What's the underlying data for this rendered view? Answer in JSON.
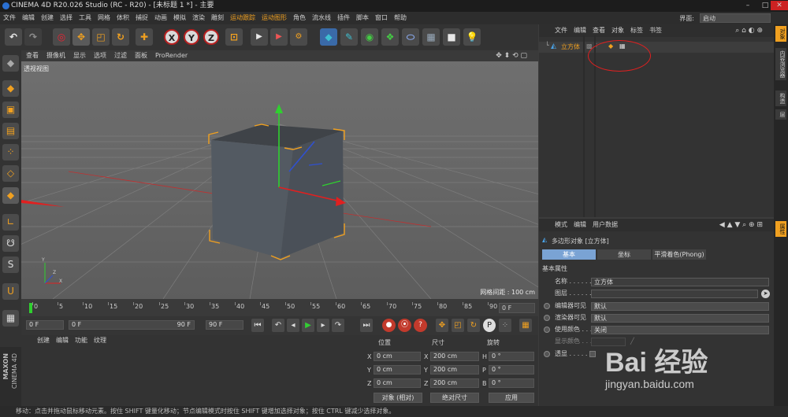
{
  "title_bar": {
    "title": "CINEMA 4D R20.026 Studio (RC - R20) - [未标题 1 *] - 主要"
  },
  "menu": {
    "items": [
      "文件",
      "编辑",
      "创建",
      "选择",
      "工具",
      "网格",
      "体积",
      "捕捉",
      "动画",
      "模拟",
      "渲染",
      "雕刻",
      "运动跟踪",
      "运动图形",
      "角色",
      "流水线",
      "插件",
      "脚本",
      "窗口",
      "帮助"
    ],
    "interface_label": "界面:",
    "interface_value": "启动"
  },
  "viewport": {
    "menu": [
      "查看",
      "摄像机",
      "显示",
      "选项",
      "过滤",
      "面板",
      "ProRender"
    ],
    "view_label": "透视视图",
    "grid_spacing": "网格间距 : 100 cm"
  },
  "timeline": {
    "ticks": [
      "0",
      "5",
      "10",
      "15",
      "20",
      "25",
      "30",
      "35",
      "40",
      "45",
      "50",
      "55",
      "60",
      "65",
      "70",
      "75",
      "80",
      "85",
      "90"
    ],
    "current_frame": "0 F"
  },
  "transport": {
    "start": "0 F",
    "range_start": "0 F",
    "range_end": "90 F",
    "end": "90 F"
  },
  "material_panel": {
    "menu": [
      "创建",
      "编辑",
      "功能",
      "纹理"
    ]
  },
  "coord_panel": {
    "headers": [
      "位置",
      "尺寸",
      "旋转"
    ],
    "rows": [
      {
        "axis": "X",
        "pos": "0 cm",
        "size_axis": "X",
        "size": "200 cm",
        "rot_axis": "H",
        "rot": "0 °"
      },
      {
        "axis": "Y",
        "pos": "0 cm",
        "size_axis": "Y",
        "size": "200 cm",
        "rot_axis": "P",
        "rot": "0 °"
      },
      {
        "axis": "Z",
        "pos": "0 cm",
        "size_axis": "Z",
        "size": "200 cm",
        "rot_axis": "B",
        "rot": "0 °"
      }
    ],
    "mode": "对象 (相对)",
    "size_mode": "绝对尺寸",
    "apply": "应用"
  },
  "object_manager": {
    "menu": [
      "文件",
      "编辑",
      "查看",
      "对象",
      "标签",
      "书签"
    ],
    "object_name": "立方体"
  },
  "attribute_manager": {
    "menu": [
      "模式",
      "编辑",
      "用户数据"
    ],
    "object_title": "多边形对象 [立方体]",
    "tabs": [
      "基本",
      "坐标",
      "平滑着色(Phong)"
    ],
    "section": "基本属性",
    "fields": [
      {
        "label": "名称 . . . . . .",
        "value": "立方体"
      },
      {
        "label": "图层 . . . . . .",
        "value": ""
      },
      {
        "label": "编辑器可见",
        "value": "默认"
      },
      {
        "label": "渲染器可见",
        "value": "默认"
      },
      {
        "label": "使用颜色 . . .",
        "value": "关闭"
      },
      {
        "label": "显示颜色 . . .",
        "value": ""
      },
      {
        "label": "透显 . . . . . .",
        "value": ""
      }
    ]
  },
  "right_tabs": [
    "对象",
    "内容浏览器",
    "构造",
    "层"
  ],
  "right_tabs_bottom": [
    "属性"
  ],
  "status": {
    "text": "移动：点击并拖动鼠标移动元素。按住 SHIFT 键量化移动；节点编辑模式时按住 SHIFT 键增加选择对象；按住 CTRL 键减少选择对象。"
  },
  "watermark": {
    "text": "Bai 经验",
    "url": "jingyan.baidu.com"
  },
  "side_brand": {
    "top": "MAXON",
    "bottom": "CINEMA 4D"
  },
  "colors": {
    "accent": "#f0a020",
    "selection": "#7aa3d4",
    "annotation": "#e02020"
  }
}
